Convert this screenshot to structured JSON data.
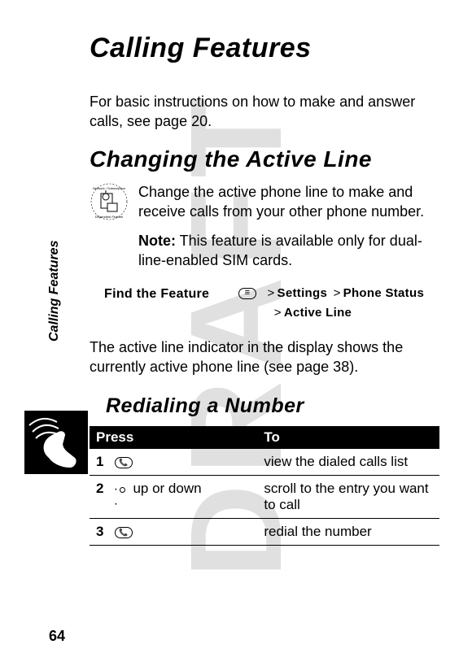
{
  "watermark": "DRAFT",
  "side_tab": "Calling Features",
  "title": "Calling Features",
  "intro": "For basic instructions on how to make and answer calls, see page 20.",
  "section1": {
    "heading": "Changing the Active Line",
    "para1": "Change the active phone line to make and receive calls from your other phone number.",
    "note_label": "Note:",
    "note_rest": " This feature is available only for dual-line-enabled SIM cards.",
    "find_feature_label": "Find the Feature",
    "path_line1_a": "Settings",
    "path_line1_b": "Phone Status",
    "path_line2": "Active Line",
    "para2": "The active line indicator in the display shows the currently active phone line (see page 38)."
  },
  "section2": {
    "heading": "Redialing a Number",
    "table": {
      "head_press": "Press",
      "head_to": "To",
      "rows": [
        {
          "n": "1",
          "press_suffix": "",
          "key": "call",
          "to": "view the dialed calls list"
        },
        {
          "n": "2",
          "press_suffix": " up or down",
          "key": "nav",
          "to": "scroll to the entry you want to call"
        },
        {
          "n": "3",
          "press_suffix": "",
          "key": "call",
          "to": "redial the number"
        }
      ]
    }
  },
  "page_number": "64"
}
